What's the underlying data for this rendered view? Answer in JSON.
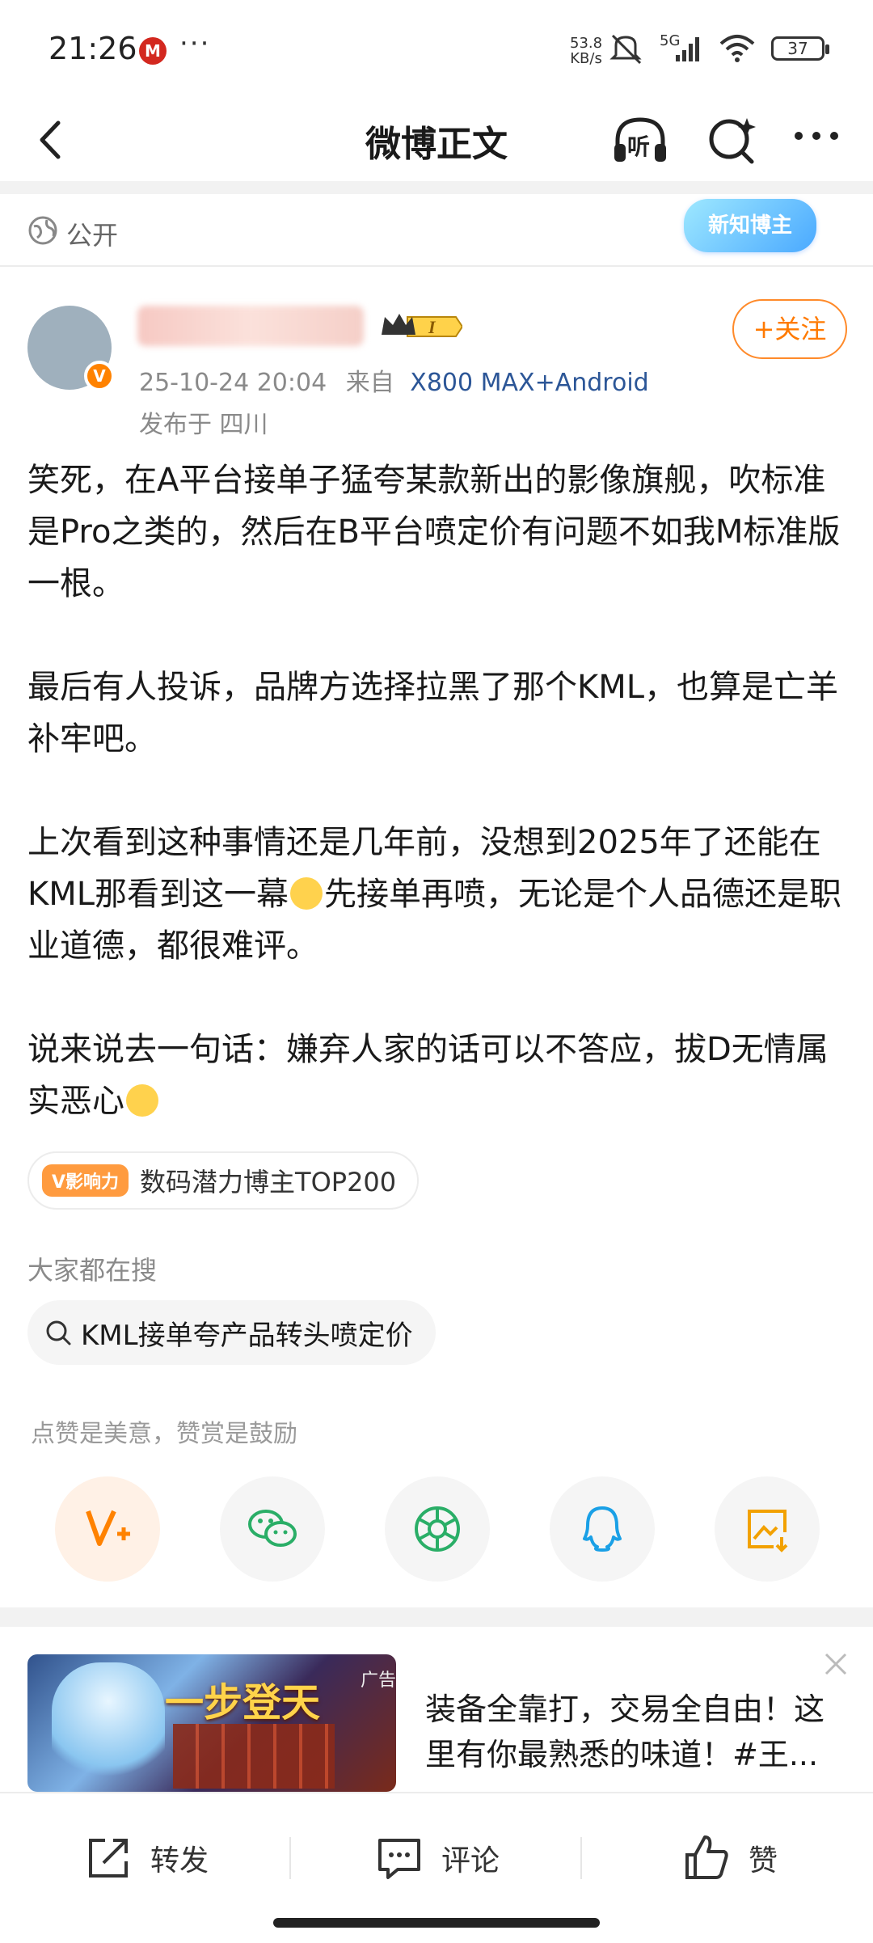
{
  "status_bar": {
    "time": "21:26",
    "more": "···",
    "speed_value": "53.8",
    "speed_unit": "KB/s",
    "network": "5G",
    "battery": "37"
  },
  "nav": {
    "title": "微博正文",
    "listen_label": "听"
  },
  "post": {
    "visibility": "公开",
    "badge": "新知博主",
    "date": "25-10-24 20:04",
    "source_prefix": "来自",
    "source": "X800 MAX+Android",
    "location": "发布于 四川",
    "follow_label": "+关注",
    "paragraphs": [
      "笑死，在A平台接单子猛夸某款新出的影像旗舰，吹标准是Pro之类的，然后在B平台喷定价有问题不如我M标准版一根。",
      "最后有人投诉，品牌方选择拉黑了那个KML，也算是亡羊补牢吧。"
    ],
    "p3_a": "上次看到这种事情还是几年前，没想到2025年了还能在KML那看到这一幕",
    "p3_b": "先接单再喷，无论是个人品德还是职业道德，都很难评。",
    "p4": "说来说去一句话：嫌弃人家的话可以不答应，拔D无情属实恶心"
  },
  "influence": {
    "badge": "V影响力",
    "text": "数码潜力博主TOP200"
  },
  "search": {
    "title": "大家都在搜",
    "query": "KML接单夸产品转头喷定价"
  },
  "reward": {
    "hint": "点赞是美意，赞赏是鼓励",
    "icons": [
      "v-plus-icon",
      "wechat-icon",
      "moments-icon",
      "qq-icon",
      "save-image-icon"
    ],
    "accent": "#ff8200"
  },
  "ad": {
    "image_title": "一步登天",
    "tag": "广告",
    "text": "装备全靠打，交易全自由！这里有你最熟悉的味道！#王..."
  },
  "bottom_bar": {
    "repost": "转发",
    "comment": "评论",
    "like": "赞"
  }
}
